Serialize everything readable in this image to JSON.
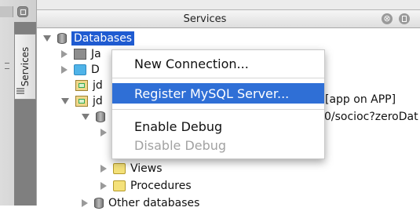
{
  "header": {
    "title": "Services",
    "close_glyph": "⊗"
  },
  "dock": {
    "tab_label": "Services"
  },
  "tree": {
    "rows": [
      {
        "label": "Databases",
        "icon": "database-icon",
        "state": "expanded"
      },
      {
        "label": "Ja",
        "icon": "drivers-jar-icon",
        "state": "collapsed"
      },
      {
        "label": "D",
        "icon": "blue-folder-icon",
        "state": "collapsed"
      },
      {
        "label": "jd",
        "icon": "connection-icon",
        "suffix": "[app on APP]"
      },
      {
        "label": "jd",
        "icon": "connection-icon",
        "suffix": "0/socioc?zeroDat",
        "state": "expanded"
      },
      {
        "label": "",
        "icon": "database-icon",
        "state": "expanded"
      },
      {
        "label": "",
        "state": "collapsed"
      },
      {
        "label": "Views",
        "icon": "folder-icon",
        "state": "collapsed"
      },
      {
        "label": "Procedures",
        "icon": "folder-icon",
        "state": "collapsed"
      },
      {
        "label": "Other databases",
        "icon": "database-icon",
        "state": "collapsed"
      }
    ]
  },
  "context_menu": {
    "items": [
      {
        "label": "New Connection...",
        "state": "normal"
      },
      {
        "label": "Register MySQL Server...",
        "state": "highlighted"
      },
      {
        "label": "Enable Debug",
        "state": "normal"
      },
      {
        "label": "Disable Debug",
        "state": "disabled"
      }
    ]
  },
  "colors": {
    "selection": "#1f5bd1",
    "menu_highlight": "#2f6fd6",
    "disabled_text": "#a2a2a2"
  }
}
